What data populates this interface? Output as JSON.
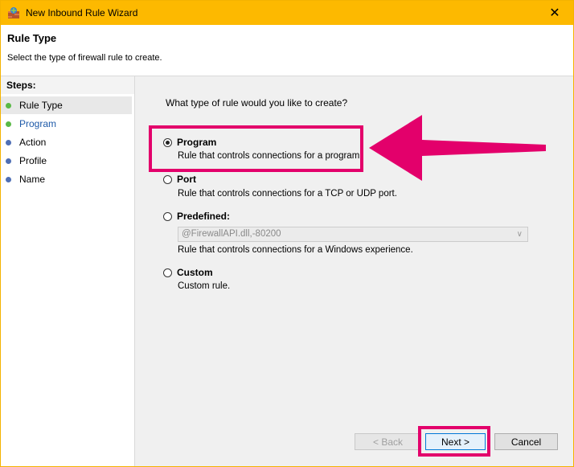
{
  "window": {
    "title": "New Inbound Rule Wizard",
    "close_glyph": "✕"
  },
  "header": {
    "title": "Rule Type",
    "subtitle": "Select the type of firewall rule to create."
  },
  "sidebar": {
    "steps_label": "Steps:",
    "items": [
      {
        "label": "Rule Type",
        "state": "done"
      },
      {
        "label": "Program",
        "state": "done"
      },
      {
        "label": "Action",
        "state": "pending"
      },
      {
        "label": "Profile",
        "state": "pending"
      },
      {
        "label": "Name",
        "state": "pending"
      }
    ]
  },
  "main": {
    "question": "What type of rule would you like to create?",
    "options": [
      {
        "label": "Program",
        "desc": "Rule that controls connections for a program.",
        "checked": true
      },
      {
        "label": "Port",
        "desc": "Rule that controls connections for a TCP or UDP port.",
        "checked": false
      },
      {
        "label": "Predefined:",
        "desc": "Rule that controls connections for a Windows experience.",
        "checked": false
      },
      {
        "label": "Custom",
        "desc": "Custom rule.",
        "checked": false
      }
    ],
    "predefined_value": "@FirewallAPI.dll,-80200"
  },
  "buttons": {
    "back": "< Back",
    "next": "Next >",
    "cancel": "Cancel"
  },
  "colors": {
    "titlebar": "#fdb900",
    "highlight": "#e3006b",
    "step_done": "#5ab947",
    "step_pending": "#4f6fb5"
  }
}
